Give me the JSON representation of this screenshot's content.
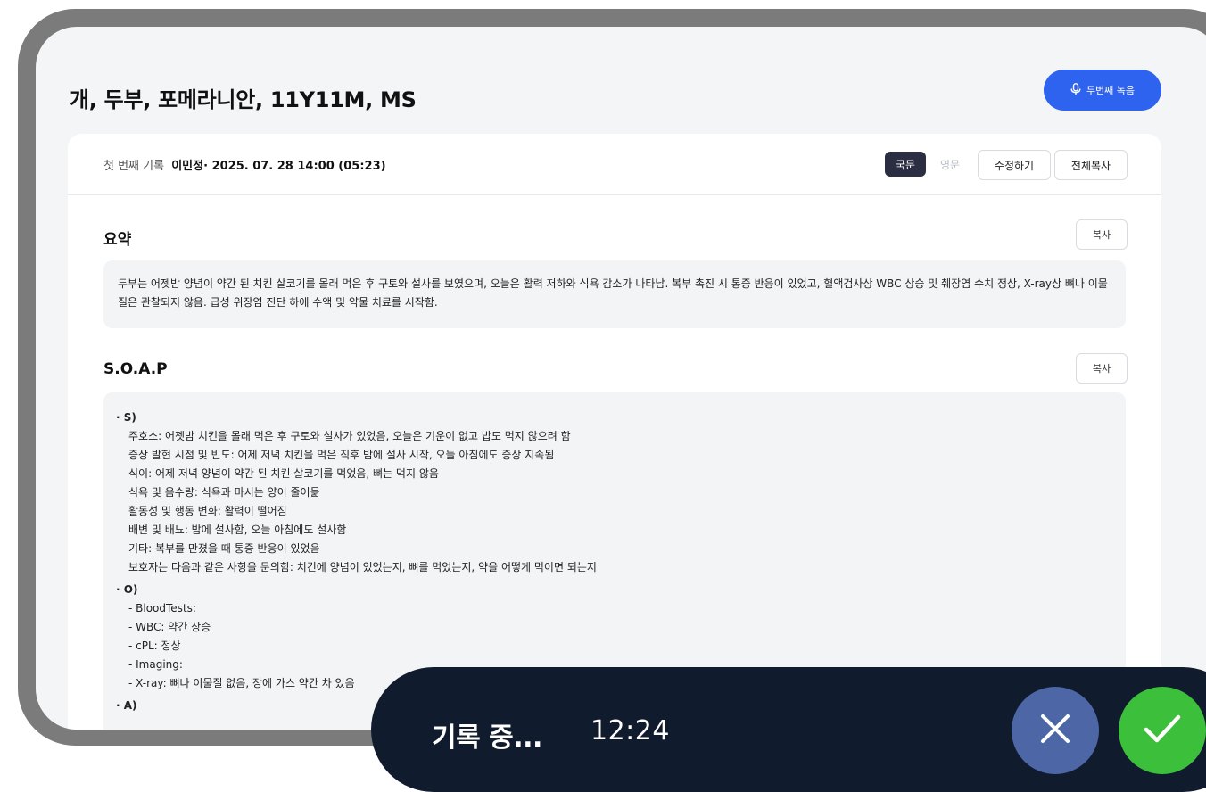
{
  "header": {
    "title": "개, 두부, 포메라니안, 11Y11M, MS",
    "record_second_label": "두번째 녹음"
  },
  "record_meta": {
    "label": "첫 번째 기록",
    "detail": "이민정· 2025. 07. 28 14:00 (05:23)",
    "lang_kr": "국문",
    "lang_en": "영문",
    "edit_label": "수정하기",
    "copy_all_label": "전체복사"
  },
  "summary": {
    "title": "요약",
    "copy_label": "복사",
    "text": "두부는 어젯밤 양념이 약간 된 치킨 살코기를 몰래 먹은 후 구토와 설사를 보였으며, 오늘은 활력 저하와 식욕 감소가 나타남. 복부 촉진 시 통증 반응이 있었고, 혈액검사상 WBC 상승 및 췌장염 수치 정상, X-ray상 뼈나 이물질은 관찰되지 않음. 급성 위장염 진단 하에 수액 및 약물 치료를 시작함."
  },
  "soap": {
    "title": "S.O.A.P",
    "copy_label": "복사",
    "sections": [
      {
        "head": "· S)",
        "lines": [
          "주호소: 어젯밤 치킨을 몰래 먹은 후 구토와 설사가 있었음, 오늘은 기운이 없고 밥도 먹지 않으려 함",
          "증상 발현 시점 및 빈도: 어제 저녁 치킨을 먹은 직후 밤에 설사 시작, 오늘 아침에도 증상 지속됨",
          "식이: 어제 저녁 양념이 약간 된 치킨 살코기를 먹었음, 뼈는 먹지 않음",
          "식욕 및 음수량: 식욕과 마시는 양이 줄어듦",
          "활동성 및 행동 변화: 활력이 떨어짐",
          "배변 및 배뇨: 밤에 설사함, 오늘 아침에도 설사함",
          "기타: 복부를 만졌을 때 통증 반응이 있었음",
          "보호자는 다음과 같은 사항을 문의함: 치킨에 양념이 있었는지, 뼈를 먹었는지, 약을 어떻게 먹이면 되는지"
        ]
      },
      {
        "head": "· O)",
        "lines": [
          "- BloodTests:",
          "- WBC: 약간 상승",
          "- cPL: 정상",
          "- Imaging:",
          "- X-ray: 뼈나 이물질 없음, 장에 가스 약간 차 있음"
        ]
      },
      {
        "head": "· A)",
        "lines": []
      }
    ]
  },
  "recording": {
    "status": "기록 중...",
    "elapsed": "12:24"
  },
  "colors": {
    "primary": "#2e63f0",
    "recording_bar": "#111b2e",
    "cancel": "#4d67a6",
    "confirm": "#3cbf3a"
  }
}
